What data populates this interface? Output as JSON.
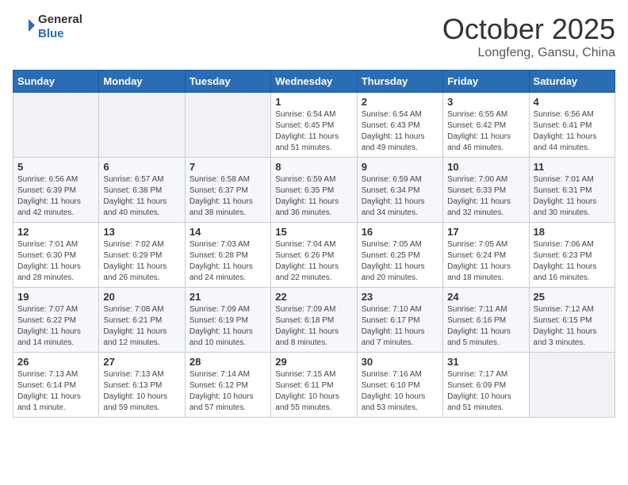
{
  "header": {
    "logo_general": "General",
    "logo_blue": "Blue",
    "month": "October 2025",
    "location": "Longfeng, Gansu, China"
  },
  "weekdays": [
    "Sunday",
    "Monday",
    "Tuesday",
    "Wednesday",
    "Thursday",
    "Friday",
    "Saturday"
  ],
  "weeks": [
    [
      {
        "day": "",
        "info": ""
      },
      {
        "day": "",
        "info": ""
      },
      {
        "day": "",
        "info": ""
      },
      {
        "day": "1",
        "info": "Sunrise: 6:54 AM\nSunset: 6:45 PM\nDaylight: 11 hours\nand 51 minutes."
      },
      {
        "day": "2",
        "info": "Sunrise: 6:54 AM\nSunset: 6:43 PM\nDaylight: 11 hours\nand 49 minutes."
      },
      {
        "day": "3",
        "info": "Sunrise: 6:55 AM\nSunset: 6:42 PM\nDaylight: 11 hours\nand 46 minutes."
      },
      {
        "day": "4",
        "info": "Sunrise: 6:56 AM\nSunset: 6:41 PM\nDaylight: 11 hours\nand 44 minutes."
      }
    ],
    [
      {
        "day": "5",
        "info": "Sunrise: 6:56 AM\nSunset: 6:39 PM\nDaylight: 11 hours\nand 42 minutes."
      },
      {
        "day": "6",
        "info": "Sunrise: 6:57 AM\nSunset: 6:38 PM\nDaylight: 11 hours\nand 40 minutes."
      },
      {
        "day": "7",
        "info": "Sunrise: 6:58 AM\nSunset: 6:37 PM\nDaylight: 11 hours\nand 38 minutes."
      },
      {
        "day": "8",
        "info": "Sunrise: 6:59 AM\nSunset: 6:35 PM\nDaylight: 11 hours\nand 36 minutes."
      },
      {
        "day": "9",
        "info": "Sunrise: 6:59 AM\nSunset: 6:34 PM\nDaylight: 11 hours\nand 34 minutes."
      },
      {
        "day": "10",
        "info": "Sunrise: 7:00 AM\nSunset: 6:33 PM\nDaylight: 11 hours\nand 32 minutes."
      },
      {
        "day": "11",
        "info": "Sunrise: 7:01 AM\nSunset: 6:31 PM\nDaylight: 11 hours\nand 30 minutes."
      }
    ],
    [
      {
        "day": "12",
        "info": "Sunrise: 7:01 AM\nSunset: 6:30 PM\nDaylight: 11 hours\nand 28 minutes."
      },
      {
        "day": "13",
        "info": "Sunrise: 7:02 AM\nSunset: 6:29 PM\nDaylight: 11 hours\nand 26 minutes."
      },
      {
        "day": "14",
        "info": "Sunrise: 7:03 AM\nSunset: 6:28 PM\nDaylight: 11 hours\nand 24 minutes."
      },
      {
        "day": "15",
        "info": "Sunrise: 7:04 AM\nSunset: 6:26 PM\nDaylight: 11 hours\nand 22 minutes."
      },
      {
        "day": "16",
        "info": "Sunrise: 7:05 AM\nSunset: 6:25 PM\nDaylight: 11 hours\nand 20 minutes."
      },
      {
        "day": "17",
        "info": "Sunrise: 7:05 AM\nSunset: 6:24 PM\nDaylight: 11 hours\nand 18 minutes."
      },
      {
        "day": "18",
        "info": "Sunrise: 7:06 AM\nSunset: 6:23 PM\nDaylight: 11 hours\nand 16 minutes."
      }
    ],
    [
      {
        "day": "19",
        "info": "Sunrise: 7:07 AM\nSunset: 6:22 PM\nDaylight: 11 hours\nand 14 minutes."
      },
      {
        "day": "20",
        "info": "Sunrise: 7:08 AM\nSunset: 6:21 PM\nDaylight: 11 hours\nand 12 minutes."
      },
      {
        "day": "21",
        "info": "Sunrise: 7:09 AM\nSunset: 6:19 PM\nDaylight: 11 hours\nand 10 minutes."
      },
      {
        "day": "22",
        "info": "Sunrise: 7:09 AM\nSunset: 6:18 PM\nDaylight: 11 hours\nand 8 minutes."
      },
      {
        "day": "23",
        "info": "Sunrise: 7:10 AM\nSunset: 6:17 PM\nDaylight: 11 hours\nand 7 minutes."
      },
      {
        "day": "24",
        "info": "Sunrise: 7:11 AM\nSunset: 6:16 PM\nDaylight: 11 hours\nand 5 minutes."
      },
      {
        "day": "25",
        "info": "Sunrise: 7:12 AM\nSunset: 6:15 PM\nDaylight: 11 hours\nand 3 minutes."
      }
    ],
    [
      {
        "day": "26",
        "info": "Sunrise: 7:13 AM\nSunset: 6:14 PM\nDaylight: 11 hours\nand 1 minute."
      },
      {
        "day": "27",
        "info": "Sunrise: 7:13 AM\nSunset: 6:13 PM\nDaylight: 10 hours\nand 59 minutes."
      },
      {
        "day": "28",
        "info": "Sunrise: 7:14 AM\nSunset: 6:12 PM\nDaylight: 10 hours\nand 57 minutes."
      },
      {
        "day": "29",
        "info": "Sunrise: 7:15 AM\nSunset: 6:11 PM\nDaylight: 10 hours\nand 55 minutes."
      },
      {
        "day": "30",
        "info": "Sunrise: 7:16 AM\nSunset: 6:10 PM\nDaylight: 10 hours\nand 53 minutes."
      },
      {
        "day": "31",
        "info": "Sunrise: 7:17 AM\nSunset: 6:09 PM\nDaylight: 10 hours\nand 51 minutes."
      },
      {
        "day": "",
        "info": ""
      }
    ]
  ]
}
